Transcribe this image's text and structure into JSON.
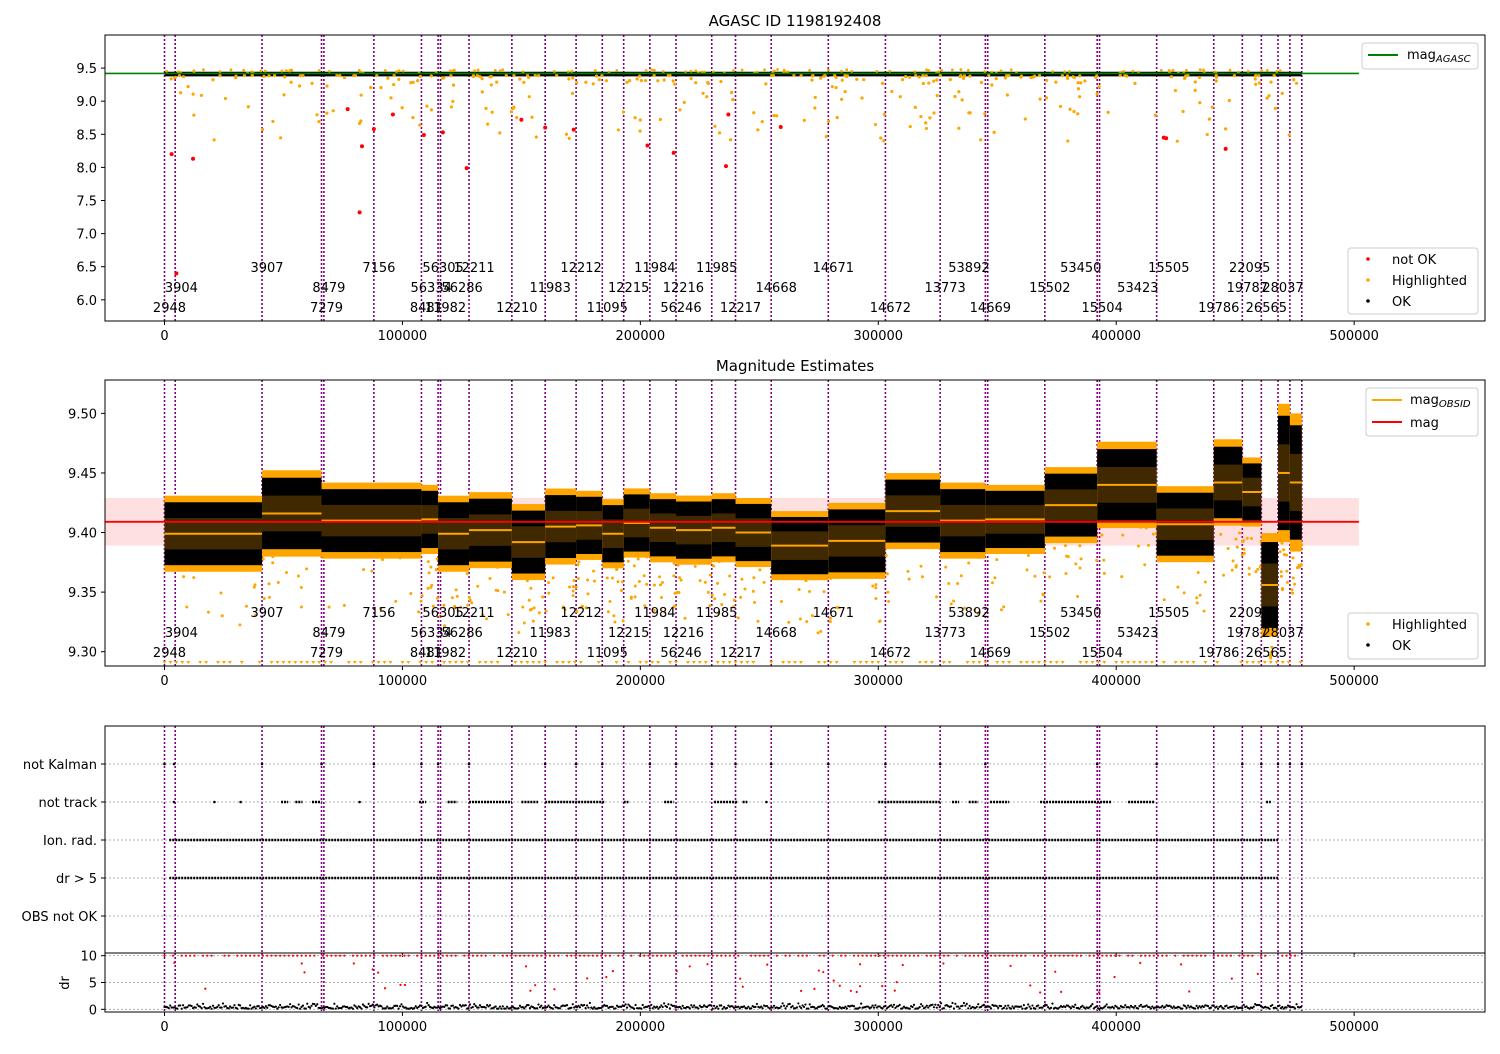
{
  "chart_data": [
    {
      "type": "scatter",
      "title": "AGASC ID 1198192408",
      "xlim": [
        -25000,
        555000
      ],
      "ylim": [
        5.68,
        10.0
      ],
      "xticks": [
        0,
        100000,
        200000,
        300000,
        400000,
        500000
      ],
      "yticks": [
        6.0,
        6.5,
        7.0,
        7.5,
        8.0,
        8.5,
        9.0,
        9.5
      ],
      "series": [
        {
          "name": "mag_AGASC",
          "kind": "line",
          "color": "#008000",
          "y": 9.42,
          "x_range": [
            -25000,
            502000
          ]
        },
        {
          "name": "OK",
          "kind": "band",
          "color": "#000000",
          "y_center": 9.41,
          "y_halfwidth": 0.035,
          "x_range": [
            0,
            478000
          ]
        },
        {
          "name": "Highlighted",
          "color": "#FFA500",
          "count": 300,
          "y_range": [
            8.4,
            9.55
          ]
        },
        {
          "name": "not OK",
          "color": "#FF0000",
          "points": [
            [
              3000,
              8.2
            ],
            [
              5000,
              6.4
            ],
            [
              12000,
              8.13
            ],
            [
              82000,
              7.32
            ],
            [
              83000,
              8.32
            ],
            [
              88000,
              8.58
            ],
            [
              77000,
              8.88
            ],
            [
              96000,
              8.8
            ],
            [
              109000,
              8.49
            ],
            [
              117000,
              8.53
            ],
            [
              127000,
              7.99
            ],
            [
              150000,
              8.72
            ],
            [
              160000,
              8.6
            ],
            [
              172000,
              8.57
            ],
            [
              203000,
              8.33
            ],
            [
              214000,
              8.22
            ],
            [
              236000,
              8.02
            ],
            [
              237000,
              8.8
            ],
            [
              259000,
              8.61
            ],
            [
              421000,
              8.44
            ],
            [
              420000,
              8.45
            ],
            [
              446000,
              8.28
            ]
          ]
        }
      ],
      "legend": {
        "position": "lower-right",
        "entries": [
          "not OK",
          "Highlighted",
          "OK"
        ]
      },
      "legend2": {
        "position": "upper-right",
        "entries": [
          "mag_AGASC"
        ]
      }
    },
    {
      "type": "scatter",
      "title": "Magnitude Estimates",
      "xlim": [
        -25000,
        555000
      ],
      "ylim": [
        9.288,
        9.528
      ],
      "xticks": [
        0,
        100000,
        200000,
        300000,
        400000,
        500000
      ],
      "yticks": [
        9.3,
        9.35,
        9.4,
        9.45,
        9.5
      ],
      "mag": 9.409,
      "mag_band": [
        9.389,
        9.429
      ],
      "segments": [
        {
          "x0": 0,
          "x1": 41000,
          "mean": 9.399,
          "sd": 0.022
        },
        {
          "x0": 41000,
          "x1": 66000,
          "mean": 9.416,
          "sd": 0.025
        },
        {
          "x0": 66000,
          "x1": 108000,
          "mean": 9.41,
          "sd": 0.022
        },
        {
          "x0": 108000,
          "x1": 115000,
          "mean": 9.411,
          "sd": 0.02
        },
        {
          "x0": 115000,
          "x1": 128000,
          "mean": 9.399,
          "sd": 0.022
        },
        {
          "x0": 128000,
          "x1": 146000,
          "mean": 9.402,
          "sd": 0.022
        },
        {
          "x0": 146000,
          "x1": 160000,
          "mean": 9.392,
          "sd": 0.022
        },
        {
          "x0": 160000,
          "x1": 173000,
          "mean": 9.405,
          "sd": 0.022
        },
        {
          "x0": 173000,
          "x1": 184000,
          "mean": 9.406,
          "sd": 0.02
        },
        {
          "x0": 184000,
          "x1": 193000,
          "mean": 9.399,
          "sd": 0.02
        },
        {
          "x0": 193000,
          "x1": 204000,
          "mean": 9.408,
          "sd": 0.02
        },
        {
          "x0": 204000,
          "x1": 215000,
          "mean": 9.404,
          "sd": 0.02
        },
        {
          "x0": 215000,
          "x1": 230000,
          "mean": 9.402,
          "sd": 0.02
        },
        {
          "x0": 230000,
          "x1": 240000,
          "mean": 9.404,
          "sd": 0.02
        },
        {
          "x0": 240000,
          "x1": 255000,
          "mean": 9.4,
          "sd": 0.02
        },
        {
          "x0": 255000,
          "x1": 279000,
          "mean": 9.389,
          "sd": 0.02
        },
        {
          "x0": 279000,
          "x1": 303000,
          "mean": 9.393,
          "sd": 0.022
        },
        {
          "x0": 303000,
          "x1": 326000,
          "mean": 9.418,
          "sd": 0.022
        },
        {
          "x0": 326000,
          "x1": 345000,
          "mean": 9.41,
          "sd": 0.022
        },
        {
          "x0": 345000,
          "x1": 370000,
          "mean": 9.411,
          "sd": 0.02
        },
        {
          "x0": 370000,
          "x1": 392000,
          "mean": 9.423,
          "sd": 0.022
        },
        {
          "x0": 392000,
          "x1": 417000,
          "mean": 9.44,
          "sd": 0.025
        },
        {
          "x0": 417000,
          "x1": 441000,
          "mean": 9.407,
          "sd": 0.022
        },
        {
          "x0": 441000,
          "x1": 453000,
          "mean": 9.442,
          "sd": 0.025
        },
        {
          "x0": 453000,
          "x1": 461000,
          "mean": 9.434,
          "sd": 0.02
        },
        {
          "x0": 461000,
          "x1": 468000,
          "mean": 9.356,
          "sd": 0.03
        },
        {
          "x0": 468000,
          "x1": 473000,
          "mean": 9.45,
          "sd": 0.04
        },
        {
          "x0": 473000,
          "x1": 478000,
          "mean": 9.442,
          "sd": 0.04
        }
      ],
      "series": [
        {
          "name": "mag_OBSID",
          "kind": "segment-lines",
          "color": "#FFA500"
        },
        {
          "name": "mag",
          "kind": "line",
          "color": "#FF0000",
          "y": 9.409,
          "x_range": [
            -25000,
            502000
          ]
        },
        {
          "name": "Highlighted",
          "color": "#FFA500"
        },
        {
          "name": "OK",
          "color": "#000000"
        }
      ],
      "legend": {
        "position": "lower-right",
        "entries": [
          "Highlighted",
          "OK"
        ]
      },
      "legend2": {
        "position": "upper-right",
        "entries": [
          "mag_OBSID",
          "mag"
        ]
      }
    },
    {
      "type": "scatter",
      "title": "",
      "xlim": [
        -25000,
        555000
      ],
      "xticks": [
        0,
        100000,
        200000,
        300000,
        400000,
        500000
      ],
      "categories": [
        "not Kalman",
        "not track",
        "Ion. rad.",
        "dr > 5",
        "OBS not OK"
      ],
      "flag_ranges": {
        "not Kalman": [
          [
            0,
            1000
          ],
          [
            4000,
            5000
          ],
          [
            41000,
            42000
          ],
          [
            66000,
            67000
          ],
          [
            88000,
            89000
          ],
          [
            108000,
            109000
          ],
          [
            115000,
            116000
          ],
          [
            128000,
            129000
          ],
          [
            160000,
            161000
          ],
          [
            173000,
            174000
          ],
          [
            184000,
            185000
          ],
          [
            204000,
            205000
          ],
          [
            215000,
            216000
          ],
          [
            230000,
            231000
          ],
          [
            240000,
            241000
          ],
          [
            255000,
            256000
          ],
          [
            279000,
            280000
          ],
          [
            303000,
            304000
          ],
          [
            326000,
            327000
          ],
          [
            345000,
            346000
          ],
          [
            392000,
            393000
          ],
          [
            417000,
            418000
          ],
          [
            453000,
            454000
          ],
          [
            461000,
            462000
          ],
          [
            468000,
            469000
          ],
          [
            473000,
            474000
          ],
          [
            478000,
            479000
          ]
        ],
        "not track": [
          [
            4000,
            5000
          ],
          [
            21000,
            22000
          ],
          [
            32000,
            33000
          ],
          [
            49000,
            52000
          ],
          [
            55000,
            58000
          ],
          [
            62000,
            66000
          ],
          [
            82000,
            83000
          ],
          [
            107000,
            110000
          ],
          [
            119000,
            123000
          ],
          [
            128000,
            146000
          ],
          [
            150000,
            157000
          ],
          [
            160000,
            185000
          ],
          [
            193000,
            195000
          ],
          [
            210000,
            214000
          ],
          [
            231000,
            241000
          ],
          [
            243000,
            245000
          ],
          [
            253000,
            254000
          ],
          [
            300000,
            326000
          ],
          [
            331000,
            334000
          ],
          [
            338000,
            342000
          ],
          [
            347000,
            355000
          ],
          [
            368000,
            398000
          ],
          [
            405000,
            416000
          ],
          [
            463000,
            465000
          ]
        ],
        "Ion. rad.": [
          [
            2000,
            468000
          ]
        ],
        "dr > 5": [
          [
            2000,
            468000
          ]
        ],
        "OBS not OK": []
      },
      "series": [
        {
          "name": "flags",
          "color": "#000000"
        }
      ]
    },
    {
      "type": "scatter",
      "title": "",
      "ylabel": "dr",
      "xlim": [
        -25000,
        555000
      ],
      "ylim": [
        -0.5,
        10.5
      ],
      "yticks": [
        0,
        5,
        10
      ],
      "xticks": [
        0,
        100000,
        200000,
        300000,
        400000,
        500000
      ],
      "xticklabels": [
        "0",
        "100000",
        "200000",
        "300000",
        "400000",
        "500000"
      ],
      "hline": 10,
      "series": [
        {
          "name": "OK",
          "color": "#000000",
          "y_range": [
            0,
            2
          ]
        },
        {
          "name": "not OK",
          "color": "#FF0000",
          "y": 10
        }
      ]
    }
  ],
  "obsids": [
    {
      "id": "2948",
      "x": 0,
      "row": 0
    },
    {
      "id": "3904",
      "x": 5000,
      "row": 1
    },
    {
      "id": "3907",
      "x": 41000,
      "row": 2
    },
    {
      "id": "7279",
      "x": 66000,
      "row": 0
    },
    {
      "id": "8479",
      "x": 67000,
      "row": 1
    },
    {
      "id": "7156",
      "x": 88000,
      "row": 2
    },
    {
      "id": "8481",
      "x": 108000,
      "row": 0
    },
    {
      "id": "56334",
      "x": 110000,
      "row": 1
    },
    {
      "id": "56305",
      "x": 115000,
      "row": 2
    },
    {
      "id": "11982",
      "x": 116000,
      "row": 0
    },
    {
      "id": "56286",
      "x": 123000,
      "row": 1
    },
    {
      "id": "12211",
      "x": 128000,
      "row": 2
    },
    {
      "id": "12210",
      "x": 146000,
      "row": 0
    },
    {
      "id": "11983",
      "x": 160000,
      "row": 1
    },
    {
      "id": "12212",
      "x": 173000,
      "row": 2
    },
    {
      "id": "11095",
      "x": 184000,
      "row": 0
    },
    {
      "id": "12215",
      "x": 193000,
      "row": 1
    },
    {
      "id": "11984",
      "x": 204000,
      "row": 2
    },
    {
      "id": "56246",
      "x": 215000,
      "row": 0
    },
    {
      "id": "12216",
      "x": 216000,
      "row": 1
    },
    {
      "id": "11985",
      "x": 230000,
      "row": 2
    },
    {
      "id": "12217",
      "x": 240000,
      "row": 0
    },
    {
      "id": "14668",
      "x": 255000,
      "row": 1
    },
    {
      "id": "14671",
      "x": 279000,
      "row": 2
    },
    {
      "id": "14672",
      "x": 303000,
      "row": 0
    },
    {
      "id": "13773",
      "x": 326000,
      "row": 1
    },
    {
      "id": "53892",
      "x": 336000,
      "row": 2
    },
    {
      "id": "14669",
      "x": 345000,
      "row": 0
    },
    {
      "id": "15502",
      "x": 370000,
      "row": 1
    },
    {
      "id": "53450",
      "x": 383000,
      "row": 2
    },
    {
      "id": "15504",
      "x": 392000,
      "row": 0
    },
    {
      "id": "53423",
      "x": 407000,
      "row": 1
    },
    {
      "id": "15505",
      "x": 420000,
      "row": 2
    },
    {
      "id": "19786",
      "x": 441000,
      "row": 0
    },
    {
      "id": "19787",
      "x": 453000,
      "row": 1
    },
    {
      "id": "22095",
      "x": 454000,
      "row": 2
    },
    {
      "id": "26565",
      "x": 461000,
      "row": 0
    },
    {
      "id": "28037",
      "x": 468000,
      "row": 1
    }
  ],
  "obs_boundaries": [
    0,
    4500,
    41000,
    66000,
    67000,
    88000,
    108000,
    115000,
    116000,
    128000,
    146000,
    160000,
    173000,
    184000,
    193000,
    204000,
    215000,
    230000,
    240000,
    255000,
    279000,
    303000,
    326000,
    345000,
    346000,
    370000,
    392000,
    393000,
    417000,
    441000,
    453000,
    461000,
    468000,
    473000,
    478000
  ]
}
